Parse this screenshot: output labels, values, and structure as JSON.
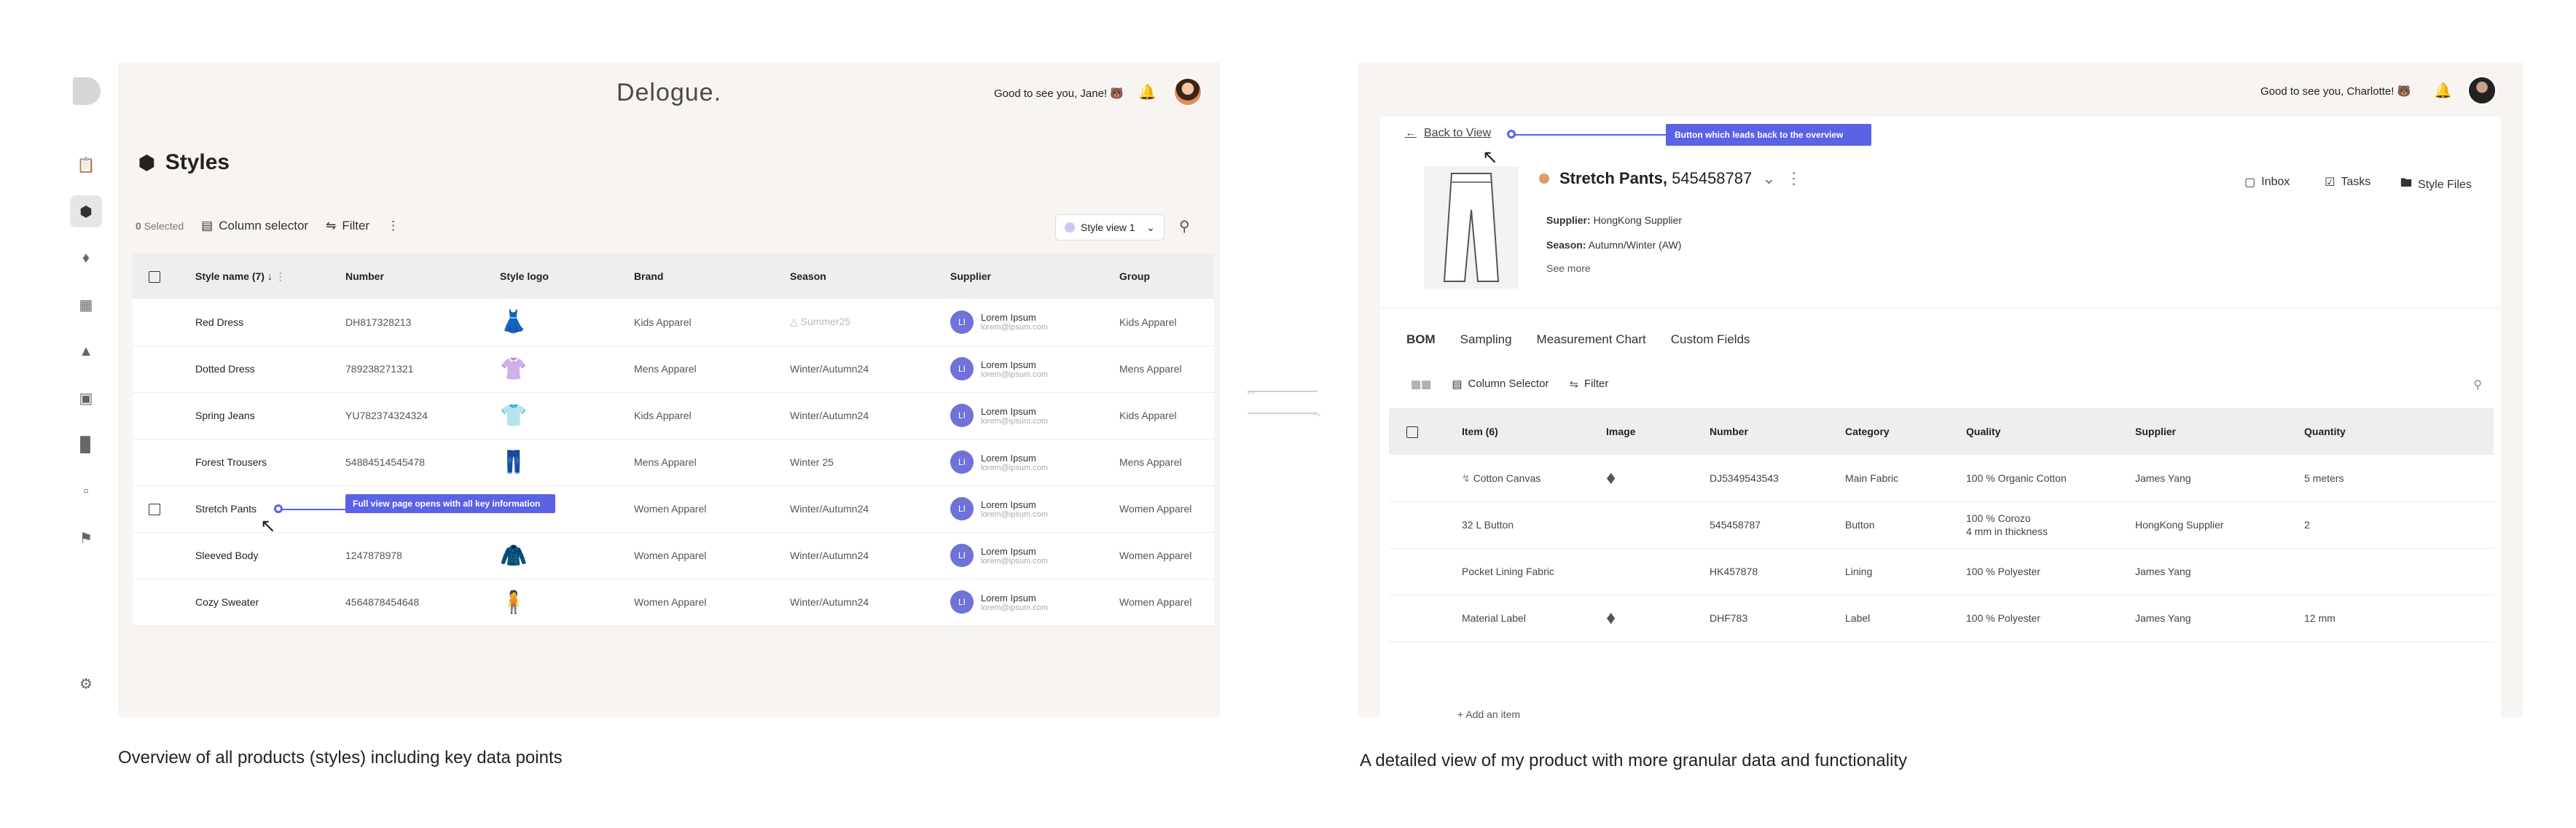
{
  "rail": {
    "icons": [
      "logo-blob",
      "clipboard-icon",
      "cube-icon",
      "puzzle-icon",
      "image-list-icon",
      "factory-icon",
      "layout-icon",
      "bar-chart-icon",
      "message-icon",
      "shipping-icon",
      "settings-icon"
    ]
  },
  "left": {
    "brand": "Delogue.",
    "greeting": "Good to see you, Jane! 🐻",
    "page_title": "Styles",
    "toolbar": {
      "selected_count": "0",
      "selected_label": "Selected",
      "column_selector": "Column selector",
      "filter": "Filter",
      "more": "⋮",
      "view": "Style view 1"
    },
    "table": {
      "headers": [
        "Style name (7)",
        "Number",
        "Style logo",
        "Brand",
        "Season",
        "Supplier",
        "Group"
      ],
      "rows": [
        {
          "name": "Red Dress",
          "number": "DH817328213",
          "logo": "👗",
          "brand": "Kids Apparel",
          "season": "Summer25",
          "season_warn": true,
          "supplier_initials": "LI",
          "supplier": "Lorem Ipsum",
          "supplier_email": "lorem@ipsum.com",
          "group": "Kids Apparel"
        },
        {
          "name": "Dotted Dress",
          "number": "789238271321",
          "logo": "👚",
          "brand": "Mens Apparel",
          "season": "Winter/Autumn24",
          "season_warn": false,
          "supplier_initials": "LI",
          "supplier": "Lorem Ipsum",
          "supplier_email": "lorem@ipsum.com",
          "group": "Mens Apparel"
        },
        {
          "name": "Spring Jeans",
          "number": "YU782374324324",
          "logo": "👕",
          "brand": "Kids Apparel",
          "season": "Winter/Autumn24",
          "season_warn": false,
          "supplier_initials": "LI",
          "supplier": "Lorem Ipsum",
          "supplier_email": "lorem@ipsum.com",
          "group": "Kids Apparel"
        },
        {
          "name": "Forest Trousers",
          "number": "54884514545478",
          "logo": "👖",
          "brand": "Mens Apparel",
          "season": "Winter 25",
          "season_warn": false,
          "supplier_initials": "LI",
          "supplier": "Lorem Ipsum",
          "supplier_email": "lorem@ipsum.com",
          "group": "Mens Apparel"
        },
        {
          "name": "Stretch Pants",
          "number": "",
          "logo": "",
          "brand": "Women Apparel",
          "season": "Winter/Autumn24",
          "season_warn": false,
          "supplier_initials": "LI",
          "supplier": "Lorem Ipsum",
          "supplier_email": "lorem@ipsum.com",
          "group": "Women Apparel"
        },
        {
          "name": "Sleeved Body",
          "number": "1247878978",
          "logo": "🧥",
          "brand": "Women Apparel",
          "season": "Winter/Autumn24",
          "season_warn": false,
          "supplier_initials": "LI",
          "supplier": "Lorem Ipsum",
          "supplier_email": "lorem@ipsum.com",
          "group": "Women Apparel"
        },
        {
          "name": "Cozy Sweater",
          "number": "4564878454648",
          "logo": "🧍",
          "brand": "Women Apparel",
          "season": "Winter/Autumn24",
          "season_warn": false,
          "supplier_initials": "LI",
          "supplier": "Lorem Ipsum",
          "supplier_email": "lorem@ipsum.com",
          "group": "Women Apparel"
        }
      ]
    },
    "tooltip": "Full view page opens with all key information",
    "caption": "Overview of all products (styles) including key data points"
  },
  "right": {
    "greeting": "Good to see you, Charlotte! 🐻",
    "back": "Back to View",
    "tooltip": "Button which leads back to the overview",
    "product": {
      "name": "Stretch Pants,",
      "number": "545458787",
      "supplier_label": "Supplier:",
      "supplier": "HongKong Supplier",
      "season_label": "Season:",
      "season": "Autumn/Winter (AW)",
      "see_more": "See more"
    },
    "quick_links": [
      "Inbox",
      "Tasks",
      "Style Files"
    ],
    "tabs": [
      "BOM",
      "Sampling",
      "Measurement Chart",
      "Custom Fields"
    ],
    "toolbar": {
      "column_selector": "Column Selector",
      "filter": "Filter"
    },
    "bom": {
      "headers": [
        "Item (6)",
        "Image",
        "Number",
        "Category",
        "Quality",
        "Supplier",
        "Quantity"
      ],
      "rows": [
        {
          "item": "Cotton Canvas",
          "linked": true,
          "image": true,
          "number": "DJ5349543543",
          "category": "Main Fabric",
          "quality": "100 % Organic Cotton",
          "quality2": "",
          "supplier": "James Yang",
          "quantity": "5 meters"
        },
        {
          "item": "32 L Button",
          "linked": false,
          "image": false,
          "number": "545458787",
          "category": "Button",
          "quality": "100 % Corozo",
          "quality2": "4 mm in thickness",
          "supplier": "HongKong Supplier",
          "quantity": "2"
        },
        {
          "item": "Pocket Lining Fabric",
          "linked": false,
          "image": false,
          "number": "HK457878",
          "category": "Lining",
          "quality": "100 % Polyester",
          "quality2": "",
          "supplier": "James Yang",
          "quantity": ""
        },
        {
          "item": "Material Label",
          "linked": false,
          "image": true,
          "number": "DHF783",
          "category": "Label",
          "quality": "100 % Polyester",
          "quality2": "",
          "supplier": "James Yang",
          "quantity": "12 mm"
        }
      ],
      "add_item": "Add an item"
    },
    "caption": "A detailed view of my product with more granular data and functionality"
  },
  "colors": {
    "accent": "#5a62e6",
    "avatar": "#6f72d8",
    "panel_bg": "#f8f4f1",
    "status_dot": "#e39a6b"
  }
}
